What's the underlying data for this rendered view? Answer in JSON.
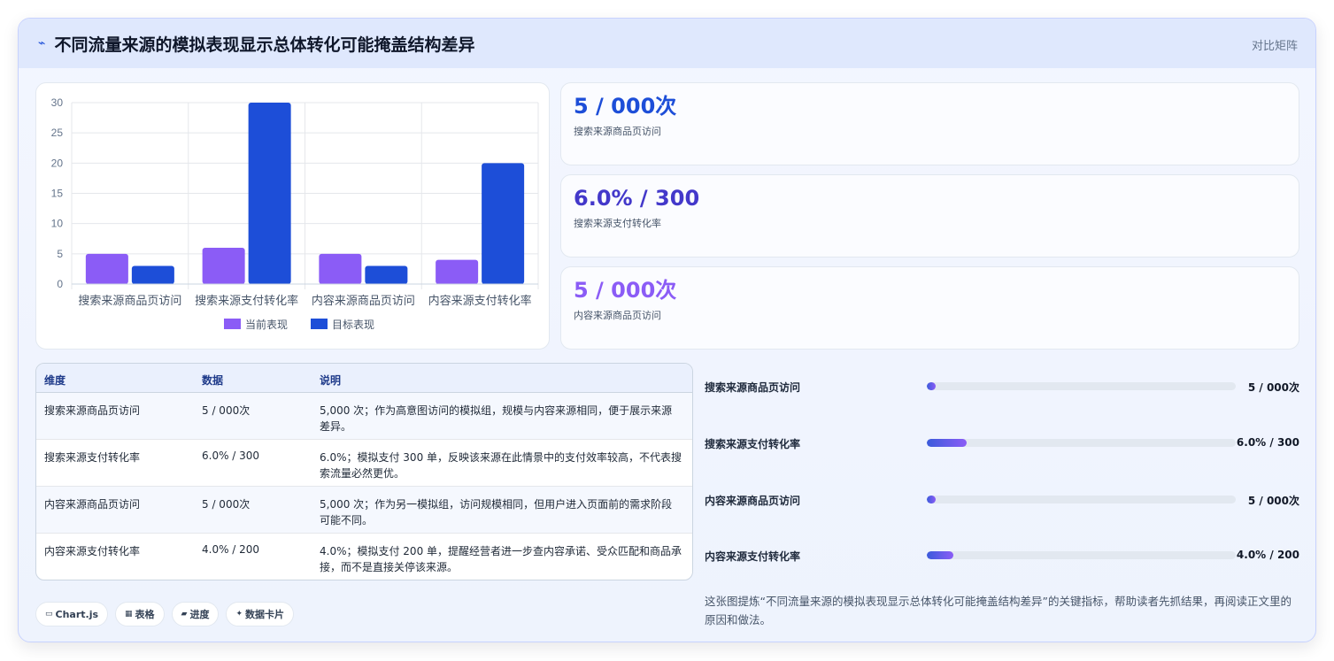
{
  "header": {
    "title": "不同流量来源的模拟表现显示总体转化可能掩盖结构差异",
    "tag": "对比矩阵"
  },
  "chart_data": {
    "type": "bar",
    "categories": [
      "搜索来源商品页访问",
      "搜索来源支付转化率",
      "内容来源商品页访问",
      "内容来源支付转化率"
    ],
    "series": [
      {
        "name": "当前表现",
        "values": [
          5,
          6,
          5,
          4
        ],
        "color": "#8b5cf6"
      },
      {
        "name": "目标表现",
        "values": [
          3,
          30,
          3,
          20
        ],
        "color": "#1d4ed8"
      }
    ],
    "ylim": [
      0,
      30
    ],
    "yticks": [
      "0",
      "5",
      "10",
      "15",
      "20",
      "25",
      "30"
    ],
    "grid": true,
    "legend": "bottom"
  },
  "stats": [
    {
      "value": "5 / 000次",
      "label": "搜索来源商品页访问",
      "color": "#1d4ed8"
    },
    {
      "value": "6.0% / 300",
      "label": "搜索来源支付转化率",
      "color": "#4338ca"
    },
    {
      "value": "5 / 000次",
      "label": "内容来源商品页访问",
      "color": "#8b5cf6"
    }
  ],
  "table": {
    "headers": [
      "维度",
      "数据",
      "说明"
    ],
    "rows": [
      {
        "dim": "搜索来源商品页访问",
        "data": "5 / 000次",
        "note": "5,000 次；作为高意图访问的模拟组，规模与内容来源相同，便于展示来源差异。"
      },
      {
        "dim": "搜索来源支付转化率",
        "data": "6.0% / 300",
        "note": "6.0%；模拟支付 300 单，反映该来源在此情景中的支付效率较高，不代表搜索流量必然更优。"
      },
      {
        "dim": "内容来源商品页访问",
        "data": "5 / 000次",
        "note": "5,000 次；作为另一模拟组，访问规模相同，但用户进入页面前的需求阶段可能不同。"
      },
      {
        "dim": "内容来源支付转化率",
        "data": "4.0% / 200",
        "note": "4.0%；模拟支付 200 单，提醒经营者进一步查内容承诺、受众匹配和商品承接，而不是直接关停该来源。"
      }
    ]
  },
  "progress": [
    {
      "label": "搜索来源商品页访问",
      "value": "5 / 000次",
      "fraction": 0.03
    },
    {
      "label": "搜索来源支付转化率",
      "value": "6.0% / 300",
      "fraction": 0.13
    },
    {
      "label": "内容来源商品页访问",
      "value": "5 / 000次",
      "fraction": 0.03
    },
    {
      "label": "内容来源支付转化率",
      "value": "4.0% / 200",
      "fraction": 0.085
    }
  ],
  "chips": [
    {
      "icon": "▭",
      "label": "Chart.js"
    },
    {
      "icon": "▦",
      "label": "表格"
    },
    {
      "icon": "▰",
      "label": "进度"
    },
    {
      "icon": "✦",
      "label": "数据卡片"
    }
  ],
  "summary": "这张图提炼“不同流量来源的模拟表现显示总体转化可能掩盖结构差异”的关键指标，帮助读者先抓结果，再阅读正文里的原因和做法。"
}
